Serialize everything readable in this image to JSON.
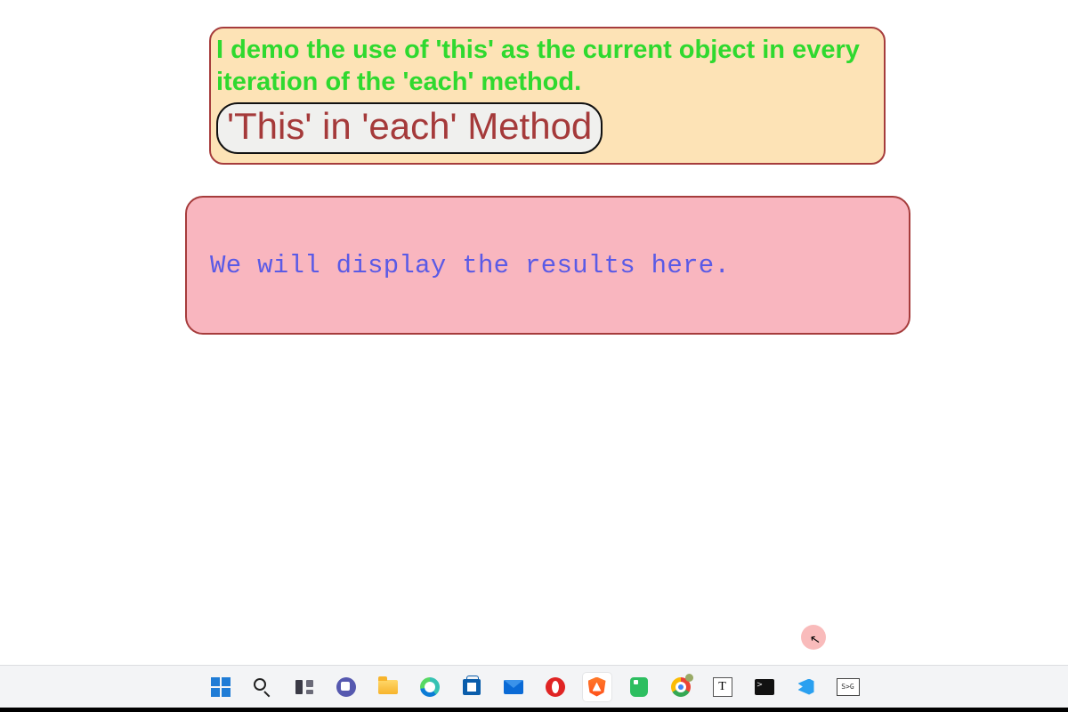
{
  "content": {
    "intro": "I demo the use of 'this' as the current object in every iteration of the 'each' method.",
    "button_label": "'This' in 'each' Method",
    "results_text": "We will display the results here."
  },
  "taskbar": {
    "items": [
      {
        "name": "start",
        "icon": "windows-icon"
      },
      {
        "name": "search",
        "icon": "search-icon"
      },
      {
        "name": "task-view",
        "icon": "taskview-icon"
      },
      {
        "name": "teams",
        "icon": "teams-icon"
      },
      {
        "name": "file-explorer",
        "icon": "folder-icon"
      },
      {
        "name": "edge",
        "icon": "edge-icon"
      },
      {
        "name": "microsoft-store",
        "icon": "store-icon"
      },
      {
        "name": "mail",
        "icon": "mail-icon"
      },
      {
        "name": "opera",
        "icon": "opera-icon"
      },
      {
        "name": "brave",
        "icon": "brave-icon",
        "active": true
      },
      {
        "name": "evernote",
        "icon": "evernote-icon"
      },
      {
        "name": "chrome",
        "icon": "chrome-icon"
      },
      {
        "name": "text-editor",
        "icon": "t-icon"
      },
      {
        "name": "terminal",
        "icon": "terminal-icon"
      },
      {
        "name": "vscode",
        "icon": "vscode-icon"
      },
      {
        "name": "svg-tool",
        "icon": "svg-icon"
      }
    ]
  }
}
